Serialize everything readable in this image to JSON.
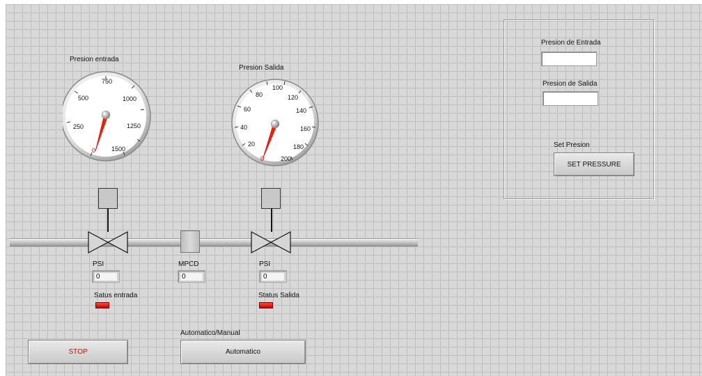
{
  "gauges": {
    "entrada": {
      "title": "Presion entrada",
      "ticks": [
        "250",
        "500",
        "750",
        "1000",
        "1250",
        "1500",
        "0"
      ],
      "needle_value": 0
    },
    "salida": {
      "title": "Presion Salida",
      "ticks": [
        "20",
        "40",
        "60",
        "80",
        "100",
        "120",
        "140",
        "160",
        "180",
        "200",
        "0"
      ],
      "needle_value": 0
    }
  },
  "left_valve": {
    "psi_label": "PSI",
    "psi_value": "0",
    "status_label": "Satus entrada",
    "status_color": "#e00000"
  },
  "flow": {
    "label": "MPCD",
    "value": "0"
  },
  "right_valve": {
    "psi_label": "PSI",
    "psi_value": "0",
    "status_label": "Status Salida",
    "status_color": "#e00000"
  },
  "controls": {
    "stop_label": "STOP",
    "stop_color": "#e00000",
    "mode_caption": "Automatico/Manual",
    "mode_label": "Automatico"
  },
  "set_panel": {
    "entrada_label": "Presion de Entrada",
    "entrada_value": "",
    "salida_label": "Presion de Salida",
    "salida_value": "",
    "set_caption": "Set Presion",
    "set_button_label": "SET PRESSURE"
  }
}
